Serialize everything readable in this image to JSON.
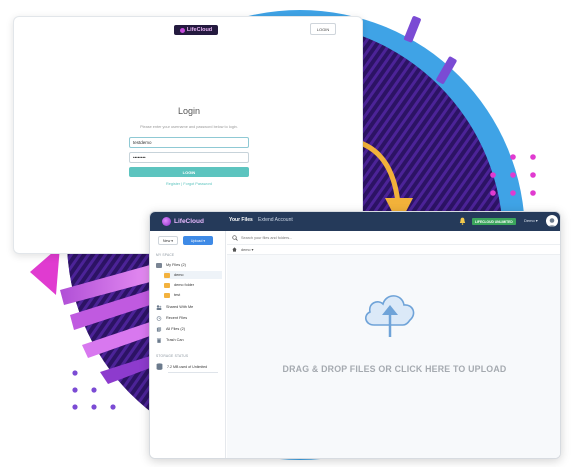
{
  "colors": {
    "brand_dark": "#253a5a",
    "accent_teal": "#5cc4bf",
    "accent_blue": "#3e8ae6",
    "decor_purple": "#3a1a78",
    "decor_magenta": "#e03bd0",
    "arrow_gold": "#f2b23a"
  },
  "login": {
    "brand": "LifeCloud",
    "top_button": "LOGIN",
    "title": "Login",
    "subtitle": "Please enter your username and password below to login.",
    "username_value": "testdemo",
    "password_value": "••••••••",
    "submit": "LOGIN",
    "links": "Register  |  Forgot Password"
  },
  "app": {
    "brand": "LifeCloud",
    "nav_tabs": [
      "Your Files",
      "Extend Account"
    ],
    "plan_badge": "LIFECLOUD UNLIMITED",
    "user": "Demo ▾",
    "toolbar": {
      "new": "New ▾",
      "upload": "Upload ▾"
    },
    "sidebar": {
      "section_my": "MY SPACE",
      "my_files": "My Files (2)",
      "folders": [
        "demo",
        "demo folder",
        "test"
      ],
      "shared": "Shared With Me",
      "recent": "Recent Files",
      "all": "All Files (2)",
      "trash": "Trash Can",
      "section_storage": "STORAGE STATUS",
      "storage_used": "7.2 MB used of Unlimited"
    },
    "search_placeholder": "Search your files and folders...",
    "breadcrumb": "demo ▾",
    "dropzone_text": "DRAG & DROP FILES OR CLICK HERE TO UPLOAD"
  }
}
